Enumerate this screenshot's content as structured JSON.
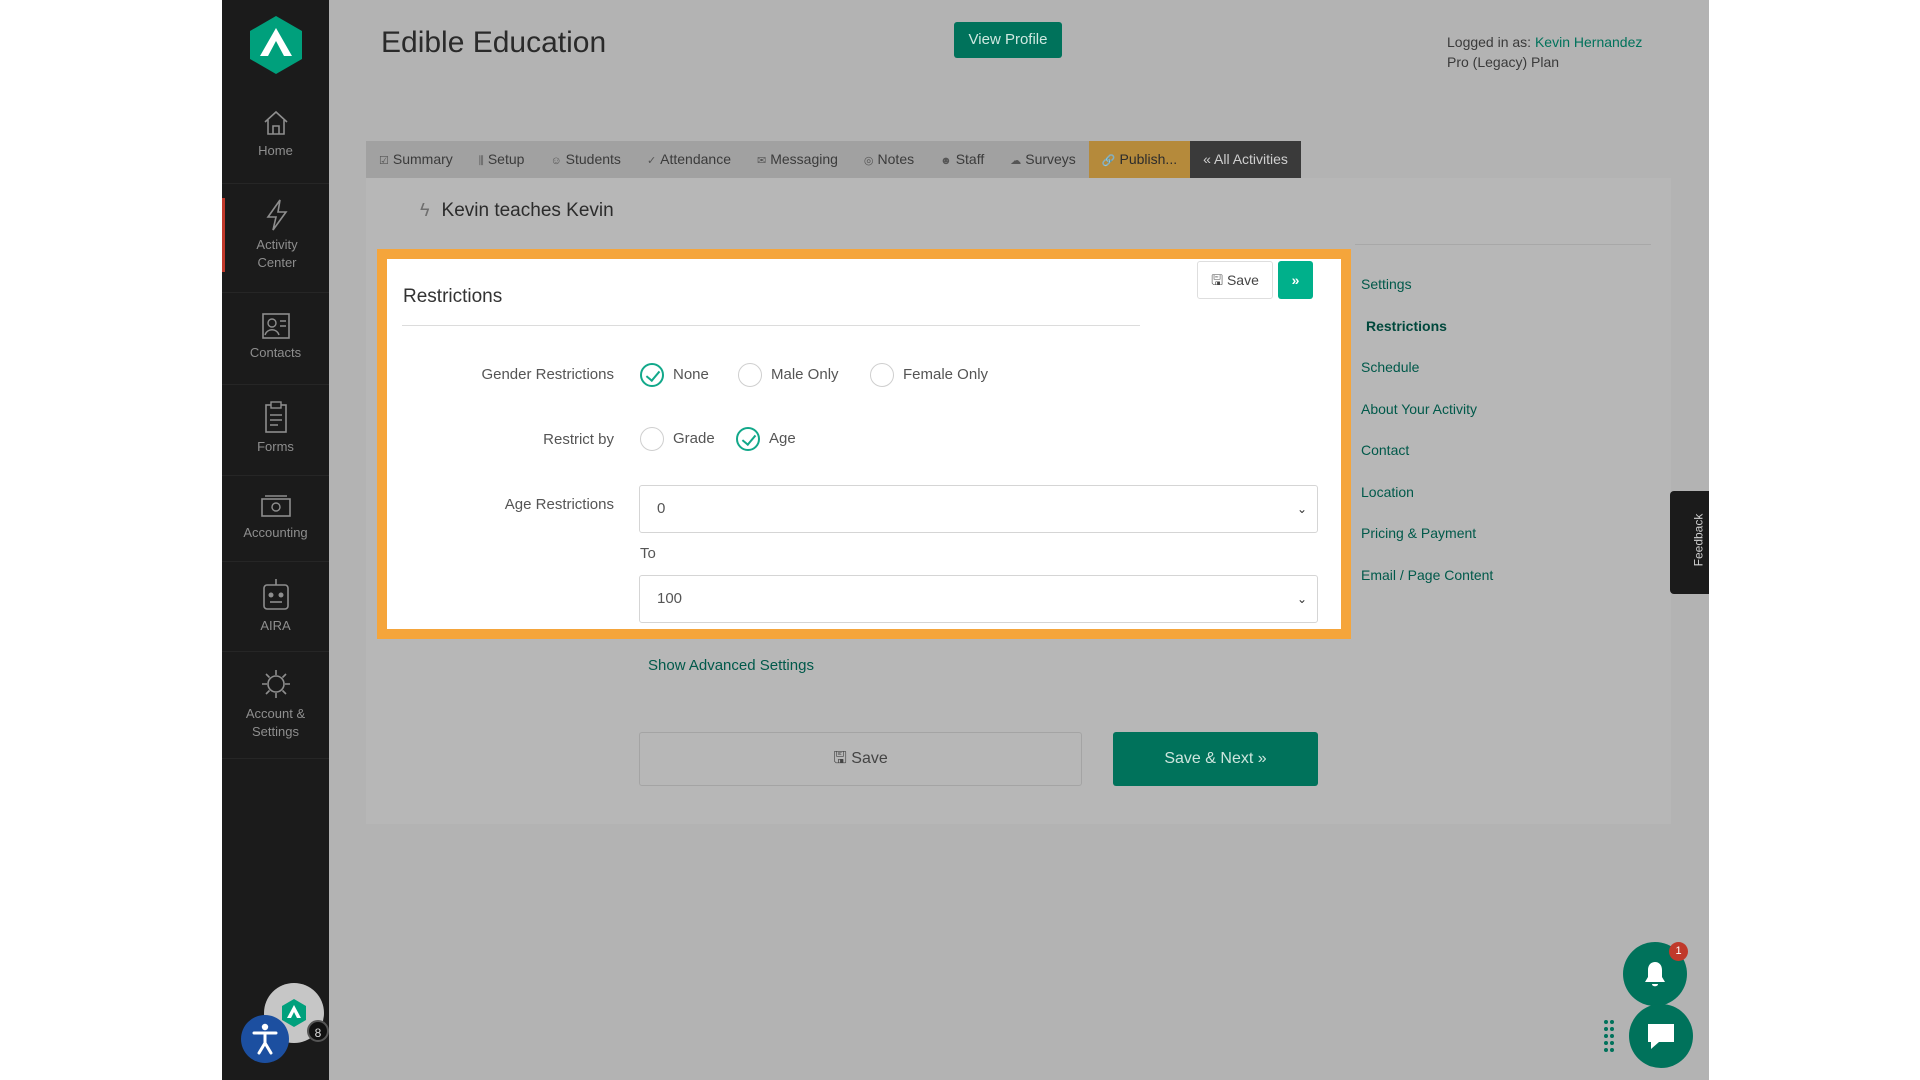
{
  "app": {
    "title": "Edible Education",
    "view_profile_label": "View Profile",
    "logged_in_prefix": "Logged in as:",
    "user_name": "Kevin Hernandez",
    "plan": "Pro (Legacy) Plan"
  },
  "sidebar": {
    "items": [
      {
        "label": "Home",
        "icon": "home-icon"
      },
      {
        "label": "Activity\nCenter",
        "icon": "bolt-icon"
      },
      {
        "label": "Contacts",
        "icon": "contacts-icon"
      },
      {
        "label": "Forms",
        "icon": "clipboard-icon"
      },
      {
        "label": "Accounting",
        "icon": "money-icon"
      },
      {
        "label": "AIRA",
        "icon": "robot-icon"
      },
      {
        "label": "Account &\nSettings",
        "icon": "gear-icon"
      }
    ],
    "avatar_badge": "8"
  },
  "tabs": [
    {
      "label": "Summary",
      "icon": "☑"
    },
    {
      "label": "Setup",
      "icon": "⫼"
    },
    {
      "label": "Students",
      "icon": "☺"
    },
    {
      "label": "Attendance",
      "icon": "✓"
    },
    {
      "label": "Messaging",
      "icon": "✉"
    },
    {
      "label": "Notes",
      "icon": "◎"
    },
    {
      "label": "Staff",
      "icon": "☻"
    },
    {
      "label": "Surveys",
      "icon": "☁"
    },
    {
      "label": "Publish...",
      "icon": "🔗"
    },
    {
      "label": "« All Activities",
      "icon": ""
    }
  ],
  "activity": {
    "title": "Kevin teaches Kevin"
  },
  "card": {
    "title": "Restrictions",
    "save_label": "Save",
    "next_label": "»"
  },
  "form": {
    "gender_label": "Gender Restrictions",
    "gender_options": [
      "None",
      "Male Only",
      "Female Only"
    ],
    "gender_selected": "None",
    "restrict_by_label": "Restrict by",
    "restrict_by_options": [
      "Grade",
      "Age"
    ],
    "restrict_by_selected": "Age",
    "age_label": "Age Restrictions",
    "age_min": "0",
    "to_label": "To",
    "age_max": "100"
  },
  "side_nav": [
    "Settings",
    "Restrictions",
    "Schedule",
    "About Your Activity",
    "Contact",
    "Location",
    "Pricing & Payment",
    "Email / Page Content"
  ],
  "side_nav_current": "Restrictions",
  "advanced_link": "Show Advanced Settings",
  "footer_buttons": {
    "save": "Save",
    "save_next": "Save & Next »"
  },
  "feedback_label": "Feedback",
  "notifications_badge": "1",
  "colors": {
    "brand_green": "#00725b",
    "accent_green": "#00b08b",
    "highlight_orange": "#f5a53b"
  }
}
